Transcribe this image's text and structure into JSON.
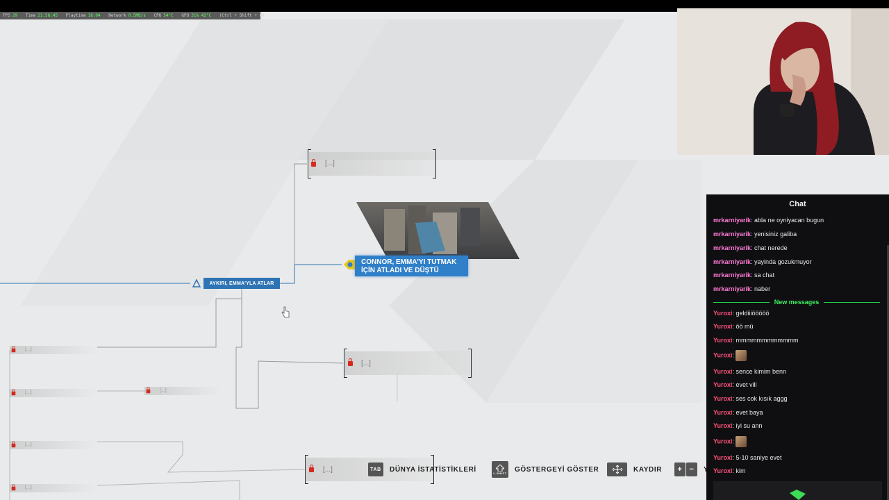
{
  "perf": [
    {
      "label": "FPS",
      "value": "29"
    },
    {
      "label": "Time",
      "value": "21:58:45"
    },
    {
      "label": "Playtime",
      "value": "18:04"
    },
    {
      "label": "Network",
      "value": "0.5MB/s"
    },
    {
      "label": "CPU",
      "value": "54°C"
    },
    {
      "label": "GPU",
      "value": "31%  42°C"
    },
    {
      "label": "(Ctrl + Shift + O)",
      "value": ""
    }
  ],
  "flowchart": {
    "locked_placeholder": "[...]",
    "active_choice_label": "AYKIRI, EMMA'YLA ATLAR",
    "ending_label_line1": "CONNOR, EMMA'YI TUTMAK",
    "ending_label_line2": "İÇİN ATLADI VE DÜŞTÜ"
  },
  "legend": {
    "tab_key": "TAB",
    "tab_label": "DÜNYA İSTATİSTİKLERİ",
    "shift_key": "L.SHIFT",
    "shift_label": "GÖSTERGEYİ GÖSTER",
    "move_label": "KAYDIR",
    "zoom_in": "+",
    "zoom_out": "−",
    "trailing": "Y"
  },
  "chat": {
    "title": "Chat",
    "divider": "New messages",
    "colors": {
      "mrkarniyarik": "#ff7ad8",
      "Yuroxi": "#ff4f7a"
    },
    "messages": [
      {
        "user": "mrkarniyarik",
        "text": ": abla ne oyniyacan bugun"
      },
      {
        "user": "mrkarniyarik",
        "text": ": yenisiniz galiba"
      },
      {
        "user": "mrkarniyarik",
        "text": ": chat nerede"
      },
      {
        "user": "mrkarniyarik",
        "text": ": yayinda gozukmuyor"
      },
      {
        "user": "mrkarniyarik",
        "text": ": sa chat"
      },
      {
        "user": "mrkarniyarik",
        "text": ": naber"
      },
      {
        "user": "Yuroxi",
        "text": ": geldiiiööööö"
      },
      {
        "user": "Yuroxi",
        "text": ": öö mü"
      },
      {
        "user": "Yuroxi",
        "text": ": mmmmmmmmmmmm"
      },
      {
        "user": "Yuroxi",
        "text": ":",
        "emote": "cat-emote"
      },
      {
        "user": "Yuroxi",
        "text": ": sence kimim benn"
      },
      {
        "user": "Yuroxi",
        "text": ": evet vill"
      },
      {
        "user": "Yuroxi",
        "text": ": ses cok kısık aggg"
      },
      {
        "user": "Yuroxi",
        "text": ": evet baya"
      },
      {
        "user": "Yuroxi",
        "text": ": iyi su ann"
      },
      {
        "user": "Yuroxi",
        "text": ":",
        "emote": "cat-emote"
      },
      {
        "user": "Yuroxi",
        "text": ": 5-10 saniye evet"
      },
      {
        "user": "Yuroxi",
        "text": ": kim"
      }
    ]
  }
}
